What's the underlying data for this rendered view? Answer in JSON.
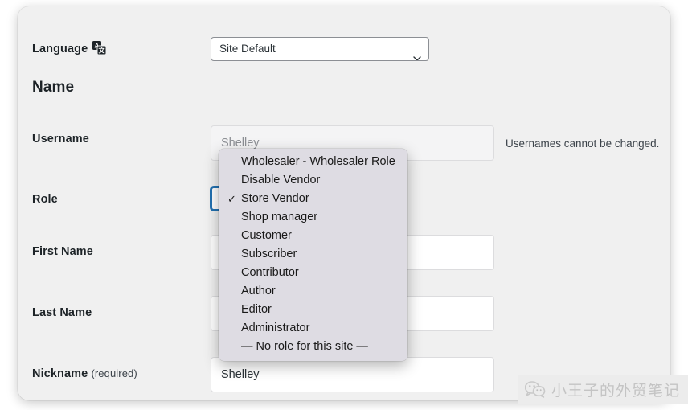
{
  "form": {
    "language": {
      "label": "Language",
      "icon": "translate-icon",
      "selected": "Site Default"
    },
    "section_heading": "Name",
    "username": {
      "label": "Username",
      "value": "Shelley",
      "hint": "Usernames cannot be changed.",
      "disabled": true
    },
    "role": {
      "label": "Role",
      "selected": "Store Vendor",
      "options": [
        {
          "label": "Wholesaler - Wholesaler Role",
          "checked": false
        },
        {
          "label": "Disable Vendor",
          "checked": false
        },
        {
          "label": "Store Vendor",
          "checked": true
        },
        {
          "label": "Shop manager",
          "checked": false
        },
        {
          "label": "Customer",
          "checked": false
        },
        {
          "label": "Subscriber",
          "checked": false
        },
        {
          "label": "Contributor",
          "checked": false
        },
        {
          "label": "Author",
          "checked": false
        },
        {
          "label": "Editor",
          "checked": false
        },
        {
          "label": "Administrator",
          "checked": false
        },
        {
          "label": "— No role for this site —",
          "checked": false
        }
      ]
    },
    "first_name": {
      "label": "First Name",
      "value": ""
    },
    "last_name": {
      "label": "Last Name",
      "value": ""
    },
    "nickname": {
      "label": "Nickname",
      "label_suffix": "(required)",
      "value": "Shelley"
    }
  },
  "watermark": {
    "icon": "wechat-icon",
    "text": "小王子的外贸笔记"
  },
  "colors": {
    "accent": "#2271b1",
    "panel_bg": "#f0f0f0",
    "menu_bg": "#dedce3",
    "text": "#1d2327"
  }
}
